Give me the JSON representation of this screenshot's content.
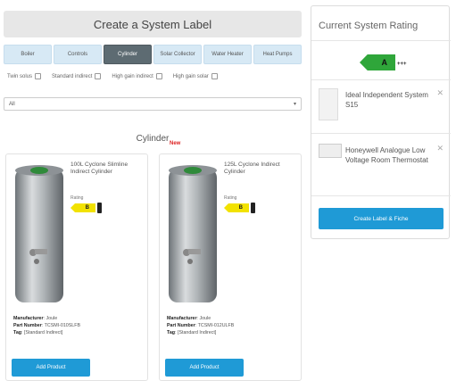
{
  "header": {
    "title": "Create a System Label"
  },
  "tabs": [
    {
      "label": "Boiler",
      "active": false
    },
    {
      "label": "Controls",
      "active": false
    },
    {
      "label": "Cylinder",
      "active": true
    },
    {
      "label": "Solar Collector",
      "active": false
    },
    {
      "label": "Water Heater",
      "active": false
    },
    {
      "label": "Heat Pumps",
      "active": false
    }
  ],
  "filters": [
    {
      "label": "Twin solus"
    },
    {
      "label": "Standard indirect"
    },
    {
      "label": "High gain indirect"
    },
    {
      "label": "High gain solar"
    }
  ],
  "select": {
    "value": "All"
  },
  "section": {
    "title": "Cylinder",
    "badge": "New"
  },
  "products": [
    {
      "name": "100L Cyclone Slimline Indirect Cylinder",
      "rating_label": "Rating",
      "rating": "B",
      "manufacturer_label": "Manufacturer",
      "manufacturer": "Joule",
      "part_label": "Part Number",
      "part": "TCSMI-010SLFB",
      "tag_label": "Tag",
      "tag": "[Standard Indirect]",
      "button": "Add Product"
    },
    {
      "name": "125L Cyclone Indirect Cylinder",
      "rating_label": "Rating",
      "rating": "B",
      "manufacturer_label": "Manufacturer",
      "manufacturer": "Joule",
      "part_label": "Part Number",
      "part": "TCSMI-012ULFB",
      "tag_label": "Tag",
      "tag": "[Standard Indirect]",
      "button": "Add Product"
    }
  ],
  "sidebar": {
    "title": "Current System Rating",
    "rating": "A",
    "rating_suffix": "+++",
    "items": [
      {
        "name": "Ideal Independent System S15"
      },
      {
        "name": "Honeywell Analogue Low Voltage Room Thermostat"
      }
    ],
    "button": "Create Label & Fiche"
  },
  "colors": {
    "accent": "#1f9ad6",
    "tab_bg": "#d7e9f5",
    "tab_active": "#5d6b72",
    "rating_b": "#f2e200",
    "rating_a": "#2fa63a",
    "new_badge": "#dd2222"
  }
}
